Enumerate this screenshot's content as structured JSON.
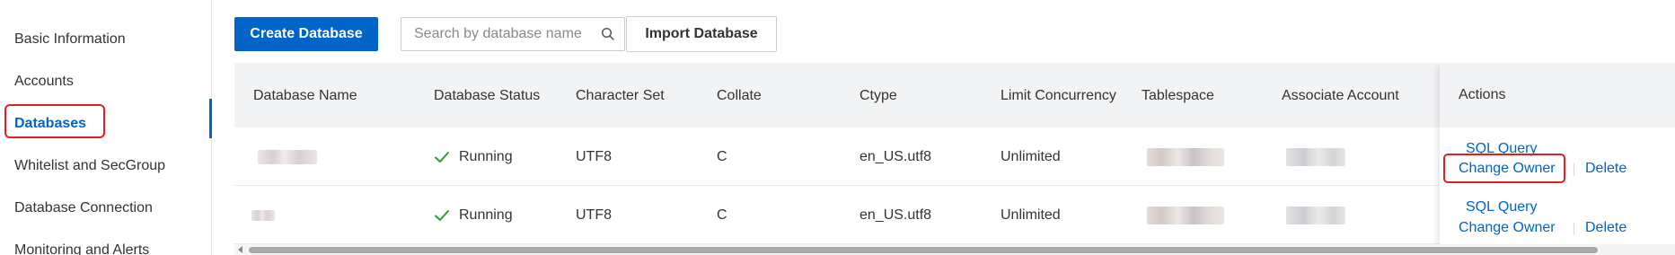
{
  "sidebar": {
    "items": [
      {
        "label": "Basic Information",
        "active": false
      },
      {
        "label": "Accounts",
        "active": false
      },
      {
        "label": "Databases",
        "active": true
      },
      {
        "label": "Whitelist and SecGroup",
        "active": false
      },
      {
        "label": "Database Connection",
        "active": false
      },
      {
        "label": "Monitoring and Alerts",
        "active": false
      }
    ]
  },
  "toolbar": {
    "create_label": "Create Database",
    "search_placeholder": "Search by database name",
    "import_label": "Import Database"
  },
  "table": {
    "headers": {
      "name": "Database Name",
      "status": "Database Status",
      "charset": "Character Set",
      "collate": "Collate",
      "ctype": "Ctype",
      "limit": "Limit Concurrency",
      "tablespace": "Tablespace",
      "account": "Associate Account",
      "actions": "Actions"
    },
    "rows": [
      {
        "name": "",
        "status": "Running",
        "charset": "UTF8",
        "collate": "C",
        "ctype": "en_US.utf8",
        "limit": "Unlimited",
        "tablespace": "",
        "account": "",
        "actions": {
          "sql": "SQL Query",
          "owner": "Change Owner",
          "delete": "Delete"
        }
      },
      {
        "name": "",
        "status": "Running",
        "charset": "UTF8",
        "collate": "C",
        "ctype": "en_US.utf8",
        "limit": "Unlimited",
        "tablespace": "",
        "account": "",
        "actions": {
          "sql": "SQL Query",
          "owner": "Change Owner",
          "delete": "Delete"
        }
      }
    ]
  },
  "colors": {
    "primary": "#0064c8",
    "status_ok": "#2a9d3a",
    "highlight": "#e02020"
  },
  "icons": {
    "search": "search-icon",
    "running": "check-icon"
  }
}
